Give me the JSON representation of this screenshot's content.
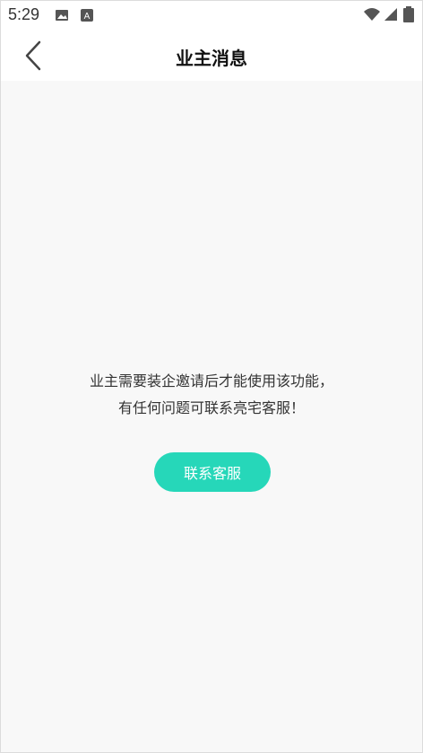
{
  "status_bar": {
    "time": "5:29",
    "icons": [
      "image-icon",
      "a-keyboard-icon",
      "wifi-icon",
      "signal-icon",
      "battery-icon"
    ]
  },
  "nav": {
    "back_icon": "chevron-left-icon",
    "title": "业主消息"
  },
  "content": {
    "message_line1": "业主需要装企邀请后才能使用该功能，",
    "message_line2": "有任何问题可联系亮宅客服！",
    "contact_button": "联系客服"
  },
  "colors": {
    "accent": "#26d7b9",
    "background": "#f8f8f8"
  }
}
